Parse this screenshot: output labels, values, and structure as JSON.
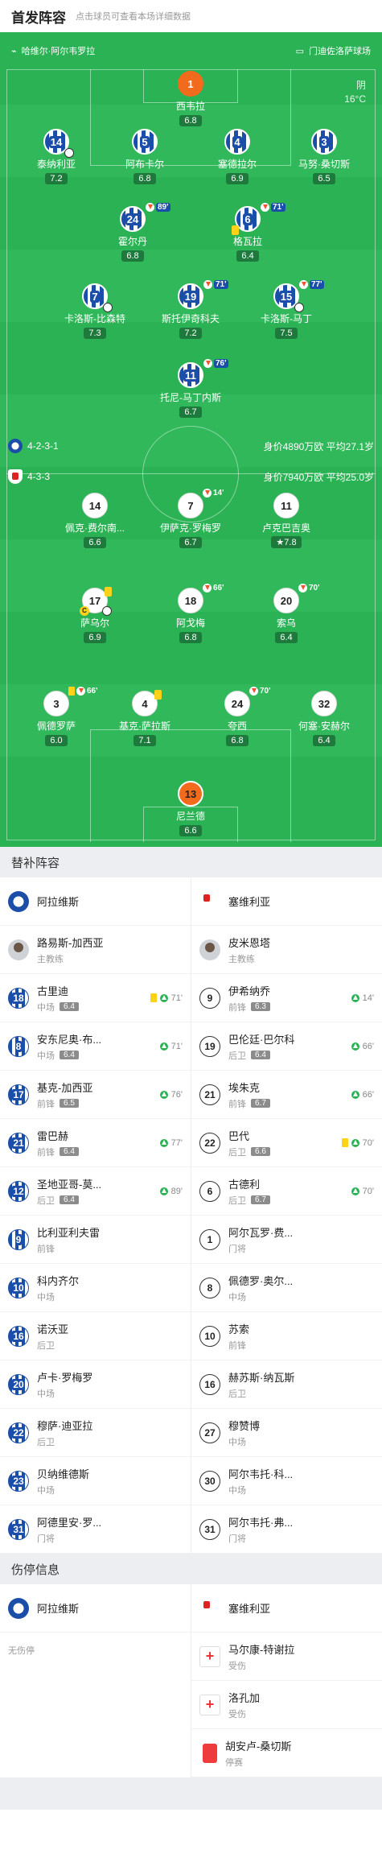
{
  "header": {
    "title": "首发阵容",
    "subtitle": "点击球员可查看本场详细数据"
  },
  "pitch": {
    "stadium_left": "哈维尔·阿尔韦罗拉",
    "stadium_right": "门迪佐洛萨球场",
    "weather": "阴",
    "temperature": "16°C",
    "home": {
      "formation": "4-2-3-1",
      "value": "身价4890万欧 平均27.1岁"
    },
    "away": {
      "formation": "4-3-3",
      "value": "身价7940万欧 平均25.0岁"
    }
  },
  "home_players": [
    {
      "no": "1",
      "name": "西韦拉",
      "rating": "6.8",
      "kit": "gk"
    },
    {
      "no": "14",
      "name": "泰纳利亚",
      "rating": "7.2",
      "kit": "blue"
    },
    {
      "no": "5",
      "name": "阿布卡尔",
      "rating": "6.8",
      "kit": "blue"
    },
    {
      "no": "4",
      "name": "塞德拉尔",
      "rating": "6.9",
      "kit": "blue"
    },
    {
      "no": "3",
      "name": "马努·桑切斯",
      "rating": "6.5",
      "kit": "blue"
    },
    {
      "no": "24",
      "name": "霍尔丹",
      "rating": "6.8",
      "kit": "blue",
      "sub": "89'"
    },
    {
      "no": "6",
      "name": "格瓦拉",
      "rating": "6.4",
      "kit": "blue",
      "sub": "71'"
    },
    {
      "no": "7",
      "name": "卡洛斯-比森特",
      "rating": "7.3",
      "kit": "blue"
    },
    {
      "no": "19",
      "name": "斯托伊奇科夫",
      "rating": "7.2",
      "kit": "blue",
      "sub": "71'"
    },
    {
      "no": "15",
      "name": "卡洛斯-马丁",
      "rating": "7.5",
      "kit": "blue",
      "sub": "77'"
    },
    {
      "no": "11",
      "name": "托尼-马丁内斯",
      "rating": "6.7",
      "kit": "blue",
      "sub": "76'"
    }
  ],
  "away_players": [
    {
      "no": "14",
      "name": "佩克·费尔南...",
      "rating": "6.6"
    },
    {
      "no": "7",
      "name": "伊萨克·罗梅罗",
      "rating": "6.7",
      "sub": "14'"
    },
    {
      "no": "11",
      "name": "卢克巴吉奥",
      "rating": "7.8"
    },
    {
      "no": "17",
      "name": "萨乌尔",
      "rating": "6.9"
    },
    {
      "no": "18",
      "name": "阿戈梅",
      "rating": "6.8",
      "sub": "66'"
    },
    {
      "no": "20",
      "name": "索乌",
      "rating": "6.4",
      "sub": "70'"
    },
    {
      "no": "3",
      "name": "佩德罗萨",
      "rating": "6.0",
      "sub": "66'"
    },
    {
      "no": "4",
      "name": "基克·萨拉斯",
      "rating": "7.1"
    },
    {
      "no": "24",
      "name": "夸西",
      "rating": "6.8",
      "sub": "70'"
    },
    {
      "no": "32",
      "name": "何塞·安赫尔",
      "rating": "6.4"
    },
    {
      "no": "13",
      "name": "尼兰德",
      "rating": "6.6",
      "kit": "gk"
    }
  ],
  "subs": {
    "title": "替补阵容",
    "home_team": "阿拉维斯",
    "away_team": "塞维利亚",
    "home_coach": {
      "name": "路易斯-加西亚",
      "role": "主教练"
    },
    "away_coach": {
      "name": "皮米恩塔",
      "role": "主教练"
    },
    "home": [
      {
        "no": "18",
        "name": "古里迪",
        "pos": "中场",
        "rating": "6.4",
        "time": "71'",
        "card": true
      },
      {
        "no": "8",
        "name": "安东尼奥·布...",
        "pos": "中场",
        "rating": "6.4",
        "time": "71'"
      },
      {
        "no": "17",
        "name": "基克-加西亚",
        "pos": "前锋",
        "rating": "6.5",
        "time": "76'"
      },
      {
        "no": "21",
        "name": "雷巴赫",
        "pos": "前锋",
        "rating": "6.4",
        "time": "77'"
      },
      {
        "no": "12",
        "name": "圣地亚哥-莫...",
        "pos": "后卫",
        "rating": "6.4",
        "time": "89'"
      },
      {
        "no": "9",
        "name": "比利亚利夫雷",
        "pos": "前锋"
      },
      {
        "no": "10",
        "name": "科内齐尔",
        "pos": "中场"
      },
      {
        "no": "16",
        "name": "诺沃亚",
        "pos": "后卫"
      },
      {
        "no": "20",
        "name": "卢卡·罗梅罗",
        "pos": "中场"
      },
      {
        "no": "22",
        "name": "穆萨·迪亚拉",
        "pos": "后卫"
      },
      {
        "no": "23",
        "name": "贝纳维德斯",
        "pos": "中场"
      },
      {
        "no": "31",
        "name": "阿德里安·罗...",
        "pos": "门将"
      }
    ],
    "away": [
      {
        "no": "9",
        "name": "伊希纳乔",
        "pos": "前锋",
        "rating": "6.3",
        "time": "14'"
      },
      {
        "no": "19",
        "name": "巴伦廷·巴尔科",
        "pos": "后卫",
        "rating": "6.4",
        "time": "66'"
      },
      {
        "no": "21",
        "name": "埃朱克",
        "pos": "前锋",
        "rating": "6.7",
        "time": "66'"
      },
      {
        "no": "22",
        "name": "巴代",
        "pos": "后卫",
        "rating": "6.6",
        "time": "70'",
        "card": true
      },
      {
        "no": "6",
        "name": "古德利",
        "pos": "后卫",
        "rating": "6.7",
        "time": "70'"
      },
      {
        "no": "1",
        "name": "阿尔瓦罗·费...",
        "pos": "门将"
      },
      {
        "no": "8",
        "name": "佩德罗·奥尔...",
        "pos": "中场"
      },
      {
        "no": "10",
        "name": "苏索",
        "pos": "前锋"
      },
      {
        "no": "16",
        "name": "赫苏斯·纳瓦斯",
        "pos": "后卫"
      },
      {
        "no": "27",
        "name": "穆赞博",
        "pos": "中场"
      },
      {
        "no": "30",
        "name": "阿尔韦托·科...",
        "pos": "中场"
      },
      {
        "no": "31",
        "name": "阿尔韦托·弗...",
        "pos": "门将"
      }
    ]
  },
  "injuries": {
    "title": "伤停信息",
    "home_team": "阿拉维斯",
    "away_team": "塞维利亚",
    "home_none": "无伤停",
    "away": [
      {
        "name": "马尔康-特谢拉",
        "status": "受伤",
        "icon": "medical-icon"
      },
      {
        "name": "洛孔加",
        "status": "受伤",
        "icon": "medical-icon"
      },
      {
        "name": "胡安卢-桑切斯",
        "status": "停赛",
        "icon": "red-card-icon"
      }
    ]
  }
}
